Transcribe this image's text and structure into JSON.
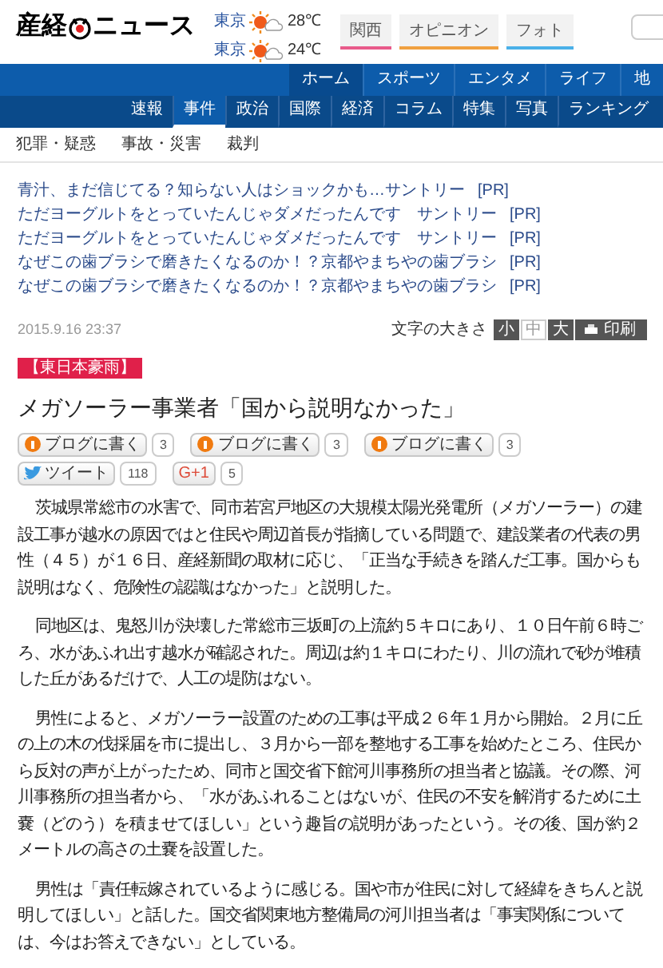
{
  "logo": {
    "left": "産経",
    "right": "ニュース"
  },
  "weather": [
    {
      "city": "東京",
      "temp": "28℃"
    },
    {
      "city": "東京",
      "temp": "24℃"
    }
  ],
  "section_tabs": [
    {
      "label": "関西",
      "color": "#e85a8a"
    },
    {
      "label": "オピニオン",
      "color": "#f0a040"
    },
    {
      "label": "フォト",
      "color": "#4ab0e8"
    }
  ],
  "main_nav": [
    {
      "label": "ホーム",
      "selected": true
    },
    {
      "label": "スポーツ",
      "selected": false
    },
    {
      "label": "エンタメ",
      "selected": false
    },
    {
      "label": "ライフ",
      "selected": false
    },
    {
      "label": "地",
      "selected": false
    }
  ],
  "sub_nav": [
    {
      "label": "速報",
      "selected": false
    },
    {
      "label": "事件",
      "selected": true
    },
    {
      "label": "政治",
      "selected": false
    },
    {
      "label": "国際",
      "selected": false
    },
    {
      "label": "経済",
      "selected": false
    },
    {
      "label": "コラム",
      "selected": false
    },
    {
      "label": "特集",
      "selected": false
    },
    {
      "label": "写真",
      "selected": false
    },
    {
      "label": "ランキング",
      "selected": false
    }
  ],
  "category_links": [
    "犯罪・疑惑",
    "事故・災害",
    "裁判"
  ],
  "pr_links": [
    {
      "text": "青汁、まだ信じてる？知らない人はショックかも…サントリー",
      "tag": "[PR]"
    },
    {
      "text": "ただヨーグルトをとっていたんじゃダメだったんです　サントリー",
      "tag": "[PR]"
    },
    {
      "text": "ただヨーグルトをとっていたんじゃダメだったんです　サントリー",
      "tag": "[PR]"
    },
    {
      "text": "なぜこの歯ブラシで磨きたくなるのか！？京都やまちやの歯ブラシ",
      "tag": "[PR]"
    },
    {
      "text": "なぜこの歯ブラシで磨きたくなるのか！？京都やまちやの歯ブラシ",
      "tag": "[PR]"
    }
  ],
  "date": "2015.9.16 23:37",
  "font_size": {
    "label": "文字の大きさ",
    "options": [
      {
        "label": "小",
        "selected": false
      },
      {
        "label": "中",
        "selected": true
      },
      {
        "label": "大",
        "selected": false
      }
    ],
    "print": "印刷"
  },
  "category_tag": "【東日本豪雨】",
  "title": "メガソーラー事業者「国から説明なかった」",
  "share": [
    {
      "kind": "blog",
      "label": "ブログに書く",
      "count": "3"
    },
    {
      "kind": "blog",
      "label": "ブログに書く",
      "count": "3"
    },
    {
      "kind": "blog",
      "label": "ブログに書く",
      "count": "3"
    },
    {
      "kind": "tweet",
      "label": "ツイート",
      "count": "118"
    },
    {
      "kind": "gplus",
      "label": "G+1",
      "count": "5"
    }
  ],
  "paragraphs": [
    "茨城県常総市の水害で、同市若宮戸地区の大規模太陽光発電所（メガソーラー）の建設工事が越水の原因ではと住民や周辺首長が指摘している問題で、建設業者の代表の男性（４５）が１６日、産経新聞の取材に応じ、「正当な手続きを踏んだ工事。国からも説明はなく、危険性の認識はなかった」と説明した。",
    "同地区は、鬼怒川が決壊した常総市三坂町の上流約５キロにあり、１０日午前６時ごろ、水があふれ出す越水が確認された。周辺は約１キロにわたり、川の流れで砂が堆積した丘があるだけで、人工の堤防はない。",
    "男性によると、メガソーラー設置のための工事は平成２６年１月から開始。２月に丘の上の木の伐採届を市に提出し、３月から一部を整地する工事を始めたところ、住民から反対の声が上がったため、同市と国交省下館河川事務所の担当者と協議。その際、河川事務所の担当者から、「水があふれることはないが、住民の不安を解消するために土嚢（どのう）を積ませてほしい」という趣旨の説明があったという。その後、国が約２メートルの高さの土嚢を設置した。",
    "男性は「責任転嫁されているように感じる。国や市が住民に対して経緯をきちんと説明してほしい」と話した。国交省関東地方整備局の河川担当者は「事実関係については、今はお答えできない」としている。"
  ]
}
